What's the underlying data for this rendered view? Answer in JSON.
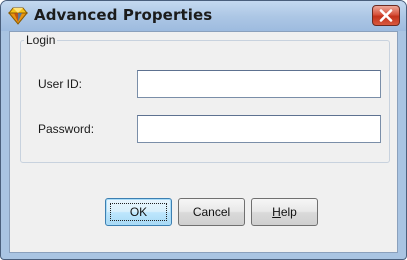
{
  "window": {
    "title": "Advanced Properties",
    "icon": "yellow-diamond-app-icon",
    "close_icon": "close-x-icon"
  },
  "login_group": {
    "legend": "Login",
    "user_id": {
      "label": "User ID:",
      "value": ""
    },
    "password": {
      "label": "Password:",
      "value": ""
    }
  },
  "buttons": {
    "ok_label": "OK",
    "cancel_label": "Cancel",
    "help_mnemonic": "H",
    "help_rest": "elp"
  },
  "colors": {
    "title_bar": "#adc7e5",
    "close_button": "#c8432a",
    "dialog_body": "#f0f0f0",
    "default_button_border": "#3c7fb1"
  }
}
